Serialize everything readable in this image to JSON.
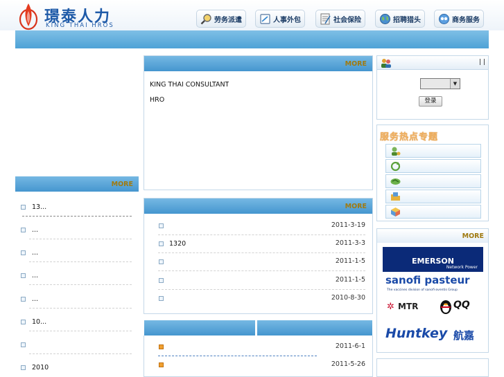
{
  "brand": {
    "name_cn": "璟泰人力",
    "name_en": "KING THAI HROS"
  },
  "nav": [
    {
      "label": "劳务派遣",
      "icon": "magnifier-icon"
    },
    {
      "label": "人事外包",
      "icon": "document-icon"
    },
    {
      "label": "社会保险",
      "icon": "form-icon"
    },
    {
      "label": "招聘猎头",
      "icon": "globe-icon"
    },
    {
      "label": "商务服务",
      "icon": "chat-icon"
    }
  ],
  "marquee": "",
  "intro": {
    "title": "",
    "more": "MORE",
    "lines": [
      "KING THAI CONSULTANT",
      "HRO",
      "",
      "",
      "",
      ""
    ]
  },
  "news": {
    "title": "",
    "more": "MORE",
    "items": [
      {
        "text": "",
        "date": "2011-3-19"
      },
      {
        "text": "1320",
        "date": "2011-3-3"
      },
      {
        "text": "",
        "date": "2011-1-5"
      },
      {
        "text": "",
        "date": "2011-1-5"
      },
      {
        "text": "",
        "date": "2010-8-30"
      }
    ]
  },
  "tabs": {
    "left": "",
    "right": ""
  },
  "tab_items": [
    {
      "text": "",
      "date": "2011-6-1"
    },
    {
      "text": "",
      "date": "2011-5-26"
    }
  ],
  "left_list": {
    "title": "",
    "more": "MORE",
    "items": [
      "13...",
      "...",
      "...",
      "...",
      "...",
      "10...",
      "",
      "2010"
    ]
  },
  "member": {
    "title": "",
    "links": " |  | ",
    "type_label": "",
    "select_value": "",
    "login_button": "登录"
  },
  "services": {
    "title": "服务热点专题",
    "items": [
      {
        "label": "",
        "icon": "person-icon"
      },
      {
        "label": "",
        "icon": "refresh-icon"
      },
      {
        "label": "",
        "icon": "handshake-icon"
      },
      {
        "label": "",
        "icon": "folder-icon"
      },
      {
        "label": "",
        "icon": "box-icon"
      }
    ]
  },
  "partners": {
    "title": "",
    "more": "MORE",
    "emerson": "EMERSON",
    "emerson_sub": "Network Power",
    "sanofi": "sanofi pasteur",
    "sanofi_sub": "The vaccines division of sanofi-aventis Group",
    "mtr": "MTR",
    "qq": "QQ",
    "huntkey": "Huntkey",
    "huntkey_cn": "航嘉"
  },
  "bottom_right": ""
}
